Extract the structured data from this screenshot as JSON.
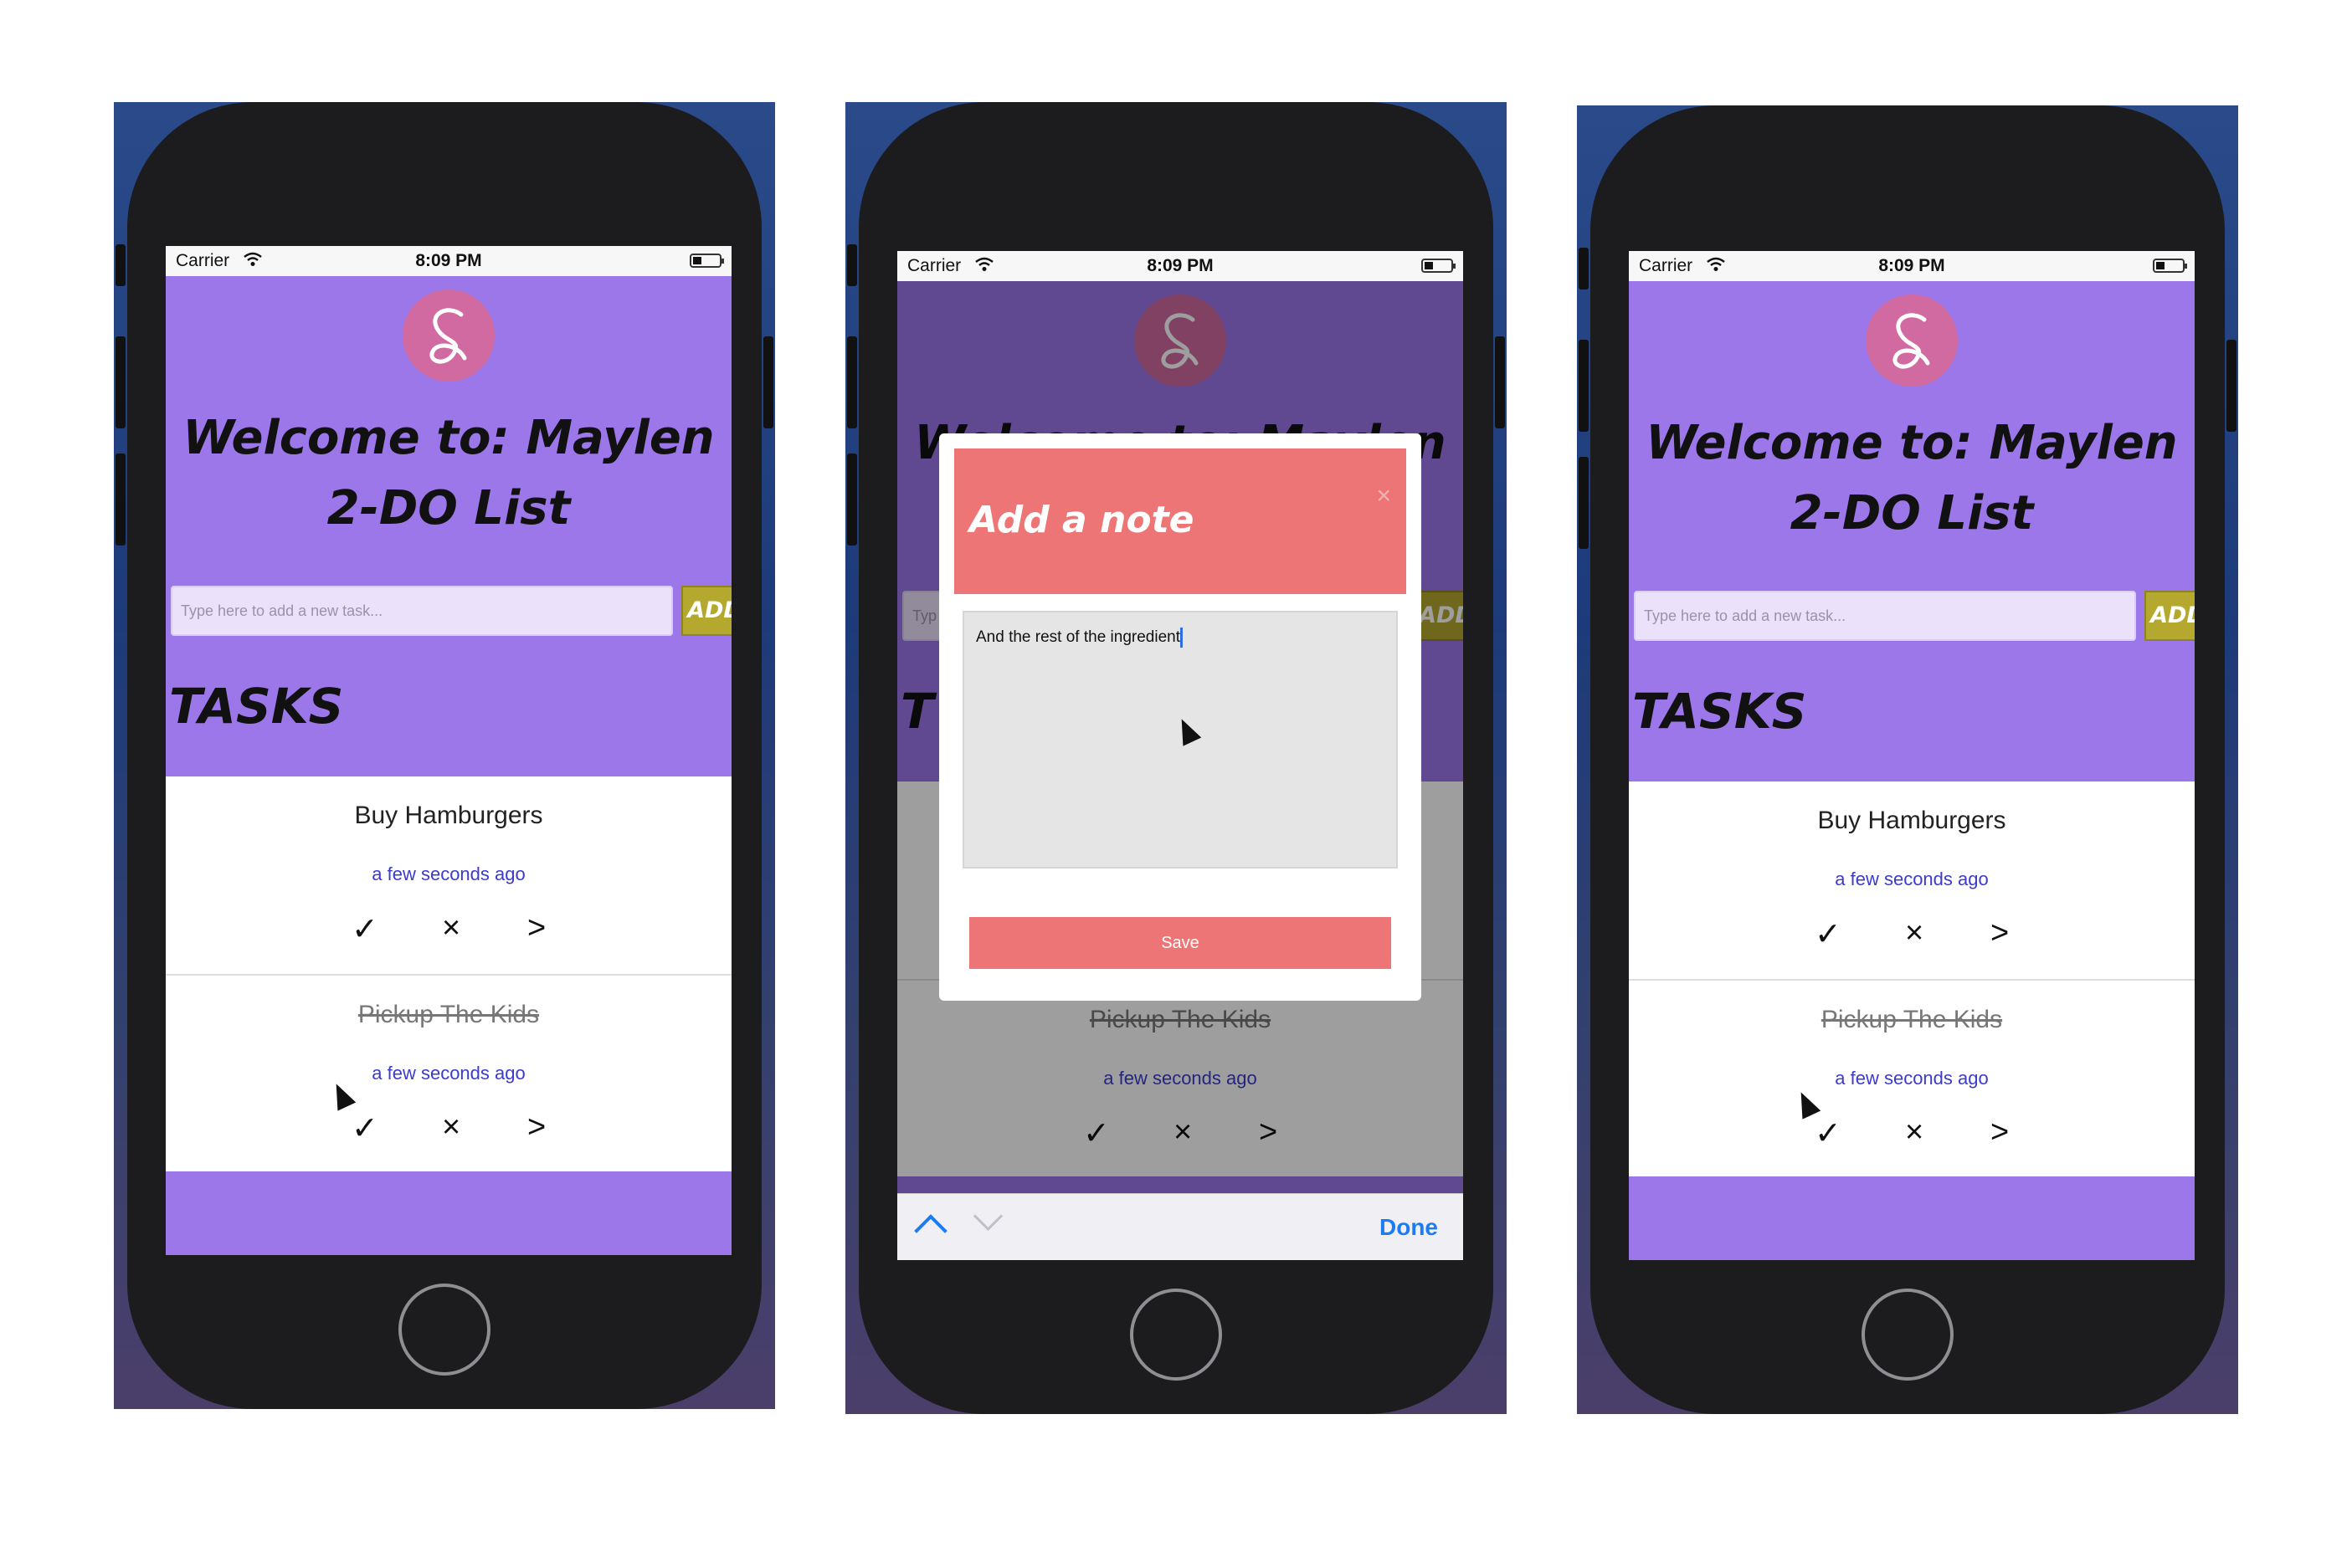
{
  "status": {
    "carrier": "Carrier",
    "time": "8:09 PM"
  },
  "app": {
    "title_line1": "Welcome to: Maylen",
    "title_line2": "2-DO List",
    "input_placeholder": "Type here to add a new task...",
    "add_label": "ADD",
    "tasks_label": "TASKS",
    "partial_tasks_label": "T",
    "partial_add_label": "ADD",
    "partial_input_placeholder": "Typ"
  },
  "tasks": [
    {
      "name": "Buy Hamburgers",
      "when": "a few seconds ago",
      "completed": false
    },
    {
      "name": "Pickup The Kids",
      "when": "a few seconds ago",
      "completed": true
    }
  ],
  "actions": {
    "check": "✓",
    "delete": "×",
    "open": ">"
  },
  "modal": {
    "title": "Add a note",
    "close": "×",
    "note_text": "And the rest of the ingredient",
    "save_label": "Save"
  },
  "keyboard_bar": {
    "done_label": "Done"
  },
  "colors": {
    "header": "#9c77ea",
    "modal_accent": "#ee7575",
    "add_button": "#b4a92e",
    "link_blue": "#3b3ad1"
  },
  "icons": [
    "wifi-icon",
    "battery-icon",
    "logo-icon",
    "cursor-icon",
    "chevron-up-icon",
    "chevron-down-icon",
    "home-button-icon"
  ]
}
